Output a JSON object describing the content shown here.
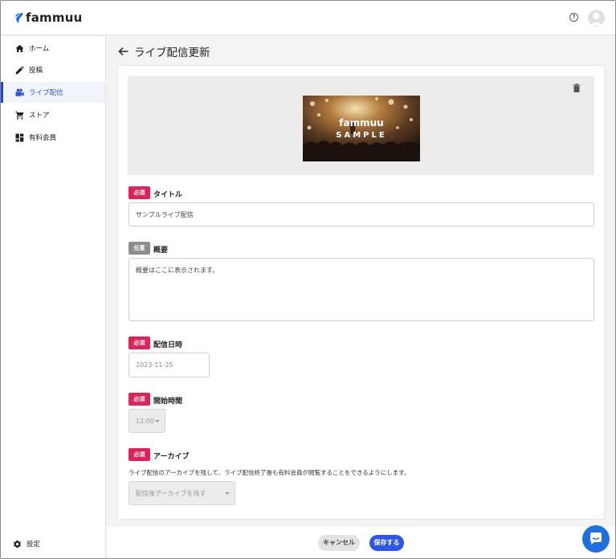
{
  "app": {
    "logo_text": "fammuu",
    "help_label": "?"
  },
  "sidebar": {
    "items": [
      {
        "label": "ホーム",
        "icon": "home-icon",
        "active": false
      },
      {
        "label": "投稿",
        "icon": "pencil-icon",
        "active": false
      },
      {
        "label": "ライブ配信",
        "icon": "live-icon",
        "active": true
      },
      {
        "label": "ストア",
        "icon": "cart-icon",
        "active": false
      },
      {
        "label": "有料会員",
        "icon": "dashboard-icon",
        "active": false
      }
    ],
    "settings_label": "設定"
  },
  "page": {
    "title": "ライブ配信更新"
  },
  "thumbnail": {
    "brand": "fammuu",
    "caption": "SAMPLE"
  },
  "form": {
    "title": {
      "badge": "必須",
      "label": "タイトル",
      "value": "サンプルライブ配信"
    },
    "summary": {
      "badge": "任意",
      "label": "概要",
      "value": "概要はここに表示されます。"
    },
    "date": {
      "badge": "必須",
      "label": "配信日時",
      "value": "2023-11-25"
    },
    "start_time": {
      "badge": "必須",
      "label": "開始時間",
      "value": "12:00"
    },
    "archive": {
      "badge": "必須",
      "label": "アーカイブ",
      "description": "ライブ配信のアーカイブを残して、ライブ配信終了後も有料会員が閲覧することをできるようにします。",
      "value": "配信後アーカイブを残す"
    }
  },
  "footer": {
    "cancel_label": "キャンセル",
    "save_label": "保存する"
  },
  "colors": {
    "accent": "#2d55e6",
    "required": "#df2257",
    "optional": "#8d8d8d",
    "active_nav": "#2f55d4"
  }
}
